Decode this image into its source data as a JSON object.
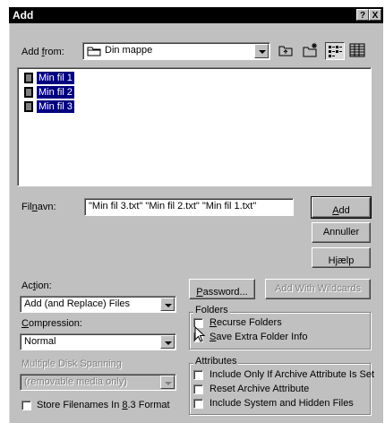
{
  "window": {
    "title": "Add",
    "help_btn": "?",
    "close_btn": "X"
  },
  "add_from": {
    "label_pre": "Add ",
    "label_u": "f",
    "label_post": "rom:",
    "folder": "Din mappe",
    "folder_icon": "folder-icon",
    "toolbar": [
      "up-one-level-icon",
      "new-folder-icon",
      "list-view-icon",
      "details-view-icon"
    ]
  },
  "files": [
    {
      "name": "Min fil 1",
      "icon": "text-file-icon"
    },
    {
      "name": "Min fil 2",
      "icon": "text-file-icon"
    },
    {
      "name": "Min fil 3",
      "icon": "text-file-icon"
    }
  ],
  "filename": {
    "label_pre": "Fil",
    "label_u": "n",
    "label_post": "avn:",
    "value": "\"Min fil 3.txt\" \"Min fil 2.txt\" \"Min fil 1.txt\""
  },
  "buttons": {
    "add_u": "A",
    "add_rest": "dd",
    "cancel": "Annuller",
    "help_pre": "H",
    "help_u": "j",
    "help_post": "ælp",
    "password_u": "P",
    "password_rest": "assword...",
    "wildcards": "Add With Wildcards"
  },
  "action": {
    "label_pre": "Ac",
    "label_u": "t",
    "label_post": "ion:",
    "value": "Add (and Replace) Files"
  },
  "compression": {
    "label_u": "C",
    "label_post": "ompression:",
    "value": "Normal"
  },
  "spanning": {
    "label": "Multiple Disk Spanning",
    "value": "(removable media only)"
  },
  "store83": {
    "label_pre": "Store Filenames In ",
    "label_u": "8",
    "label_post": ".3 Format",
    "checked": false
  },
  "folders": {
    "title": "Folders",
    "recurse_u": "R",
    "recurse_rest": "ecurse Folders",
    "recurse_checked": false,
    "save_u": "S",
    "save_rest": "ave Extra Folder Info",
    "save_checked": false
  },
  "attributes": {
    "title": "Attributes",
    "items": [
      {
        "label": "Include Only If Archive Attribute Is Set",
        "checked": false
      },
      {
        "label": "Reset Archive Attribute",
        "checked": false
      },
      {
        "label": "Include System and Hidden Files",
        "checked": false
      }
    ]
  }
}
